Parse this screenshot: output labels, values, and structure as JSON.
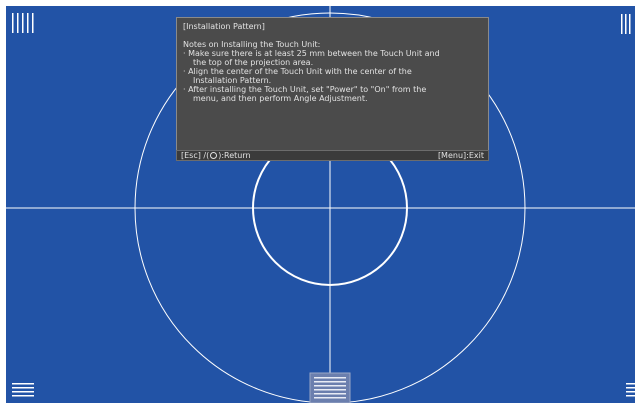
{
  "screen": {
    "background": "#2253a6",
    "line_color": "#ffffff"
  },
  "dialog": {
    "title": "[Installation Pattern]",
    "notes_heading": "Notes on Installing the Touch Unit:",
    "lines": [
      "· Make sure there is at least 25 mm between the Touch Unit and",
      "  the top of the projection area.",
      "· Align the center of the Touch Unit with the center of the",
      "  Installation Pattern.",
      "· After installing the Touch Unit, set \"Power\" to \"On\" from the",
      "  menu, and then perform Angle Adjustment."
    ]
  },
  "footer": {
    "return_prefix": "[Esc] /(",
    "return_suffix": "):Return",
    "return_icon": "return-icon",
    "exit_label": "[Menu]:Exit"
  }
}
